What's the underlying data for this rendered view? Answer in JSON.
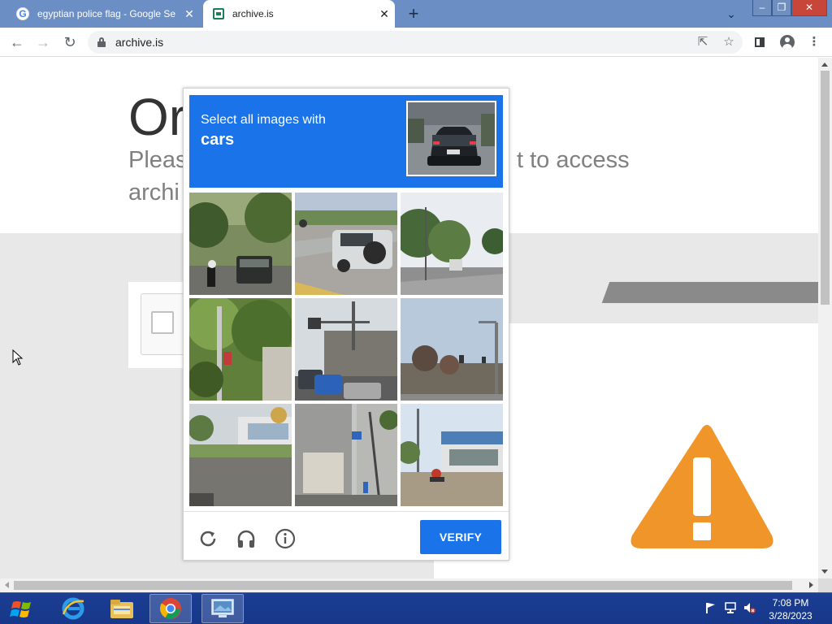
{
  "browser": {
    "tabs": [
      {
        "title": "egyptian police flag - Google Se",
        "favicon": "google-g-icon",
        "active": false
      },
      {
        "title": "archive.is",
        "favicon": "archive-icon",
        "active": true
      }
    ],
    "new_tab": "+",
    "address": "archive.is",
    "favicon_letter": "G"
  },
  "page": {
    "heading": "Or",
    "sub_line1_left": "Pleas",
    "sub_line1_right": "t to access",
    "sub_line2": "archi"
  },
  "captcha": {
    "instruction": "Select all images with",
    "target": "cars",
    "verify_label": "VERIFY",
    "tiles": [
      "tile-1",
      "tile-2",
      "tile-3",
      "tile-4",
      "tile-5",
      "tile-6",
      "tile-7",
      "tile-8",
      "tile-9"
    ],
    "accent_color": "#1a73e8"
  },
  "taskbar": {
    "time": "7:08 PM",
    "date": "3/28/2023",
    "apps": [
      "internet-explorer",
      "file-explorer",
      "chrome",
      "remote-desktop"
    ]
  }
}
